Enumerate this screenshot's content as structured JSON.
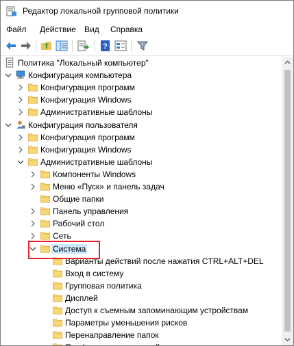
{
  "window": {
    "title": "Редактор локальной групповой политики"
  },
  "menu": [
    "Файл",
    "Действие",
    "Вид",
    "Справка"
  ],
  "toolbar": {
    "buttons": [
      "back-icon",
      "forward-icon",
      "up-folder-icon",
      "show-hide-tree-icon",
      "export-list-icon",
      "help-icon",
      "properties-view-icon",
      "filter-icon"
    ]
  },
  "tree": [
    {
      "label": "Политика \"Локальный компьютер\"",
      "icon": "policy-doc-icon",
      "indent": 0,
      "chevron": "none"
    },
    {
      "label": "Конфигурация компьютера",
      "icon": "computer-icon",
      "indent": 1,
      "chevron": "down"
    },
    {
      "label": "Конфигурация программ",
      "icon": "folder-icon",
      "indent": 2,
      "chevron": "right"
    },
    {
      "label": "Конфигурация Windows",
      "icon": "folder-icon",
      "indent": 2,
      "chevron": "right"
    },
    {
      "label": "Административные шаблоны",
      "icon": "folder-icon",
      "indent": 2,
      "chevron": "right"
    },
    {
      "label": "Конфигурация пользователя",
      "icon": "user-icon",
      "indent": 1,
      "chevron": "down"
    },
    {
      "label": "Конфигурация программ",
      "icon": "folder-icon",
      "indent": 2,
      "chevron": "right"
    },
    {
      "label": "Конфигурация Windows",
      "icon": "folder-icon",
      "indent": 2,
      "chevron": "right"
    },
    {
      "label": "Административные шаблоны",
      "icon": "folder-icon",
      "indent": 2,
      "chevron": "down"
    },
    {
      "label": "Компоненты Windows",
      "icon": "folder-icon",
      "indent": 3,
      "chevron": "right"
    },
    {
      "label": "Меню «Пуск» и панель задач",
      "icon": "folder-icon",
      "indent": 3,
      "chevron": "right"
    },
    {
      "label": "Общие папки",
      "icon": "folder-icon",
      "indent": 3,
      "chevron": "none"
    },
    {
      "label": "Панель управления",
      "icon": "folder-icon",
      "indent": 3,
      "chevron": "right"
    },
    {
      "label": "Рабочий стол",
      "icon": "folder-icon",
      "indent": 3,
      "chevron": "right"
    },
    {
      "label": "Сеть",
      "icon": "folder-icon",
      "indent": 3,
      "chevron": "right"
    },
    {
      "label": "Система",
      "icon": "folder-icon",
      "indent": 3,
      "chevron": "down",
      "selected": true
    },
    {
      "label": "Варианты действий после нажатия CTRL+ALT+DEL",
      "icon": "folder-icon",
      "indent": 4,
      "chevron": "none"
    },
    {
      "label": "Вход в систему",
      "icon": "folder-icon",
      "indent": 4,
      "chevron": "none"
    },
    {
      "label": "Групповая политика",
      "icon": "folder-icon",
      "indent": 4,
      "chevron": "none"
    },
    {
      "label": "Дисплей",
      "icon": "folder-icon",
      "indent": 4,
      "chevron": "none"
    },
    {
      "label": "Доступ к съемным запоминающим устройствам",
      "icon": "folder-icon",
      "indent": 4,
      "chevron": "none"
    },
    {
      "label": "Параметры уменьшения рисков",
      "icon": "folder-icon",
      "indent": 4,
      "chevron": "none"
    },
    {
      "label": "Перенаправление папок",
      "icon": "folder-icon",
      "indent": 4,
      "chevron": "none"
    },
    {
      "label": "Профили пользователей",
      "icon": "folder-icon",
      "indent": 4,
      "chevron": "none"
    }
  ],
  "colors": {
    "selection": "#cce8ff",
    "highlight_box": "#e3222c",
    "folder": "#f8d775"
  }
}
